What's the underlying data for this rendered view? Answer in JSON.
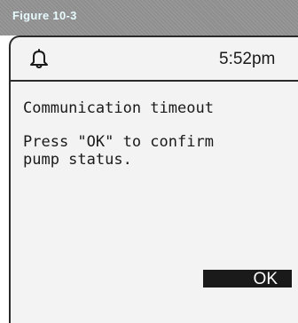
{
  "figure": {
    "label": "Figure 10-3"
  },
  "status_bar": {
    "alert_icon": "bell-icon",
    "time": "5:52pm"
  },
  "alert": {
    "title": "Communication timeout",
    "message": "Press \"OK\" to confirm\npump status."
  },
  "actions": {
    "ok_label": "OK"
  },
  "colors": {
    "figure_band": "#8e8e8e",
    "figure_label": "#e8fbff",
    "screen_background": "#f3f3f3",
    "text": "#1a1a1a",
    "button_background": "#1a1a1a",
    "button_text": "#ffffff"
  }
}
